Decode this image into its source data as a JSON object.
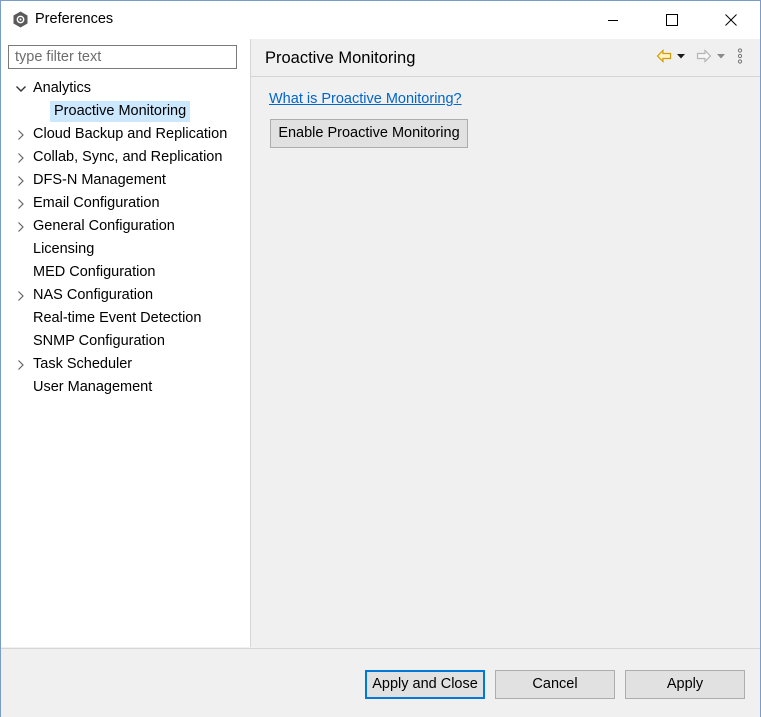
{
  "window": {
    "title": "Preferences",
    "icon": "app-gear-icon"
  },
  "filter": {
    "placeholder": "type filter text",
    "value": ""
  },
  "tree": {
    "items": [
      {
        "label": "Analytics",
        "expanded": true,
        "has_children": true
      },
      {
        "label": "Proactive Monitoring",
        "child": true,
        "selected": true
      },
      {
        "label": "Cloud Backup and Replication",
        "has_children": true
      },
      {
        "label": "Collab, Sync, and Replication",
        "has_children": true
      },
      {
        "label": "DFS-N Management",
        "has_children": true
      },
      {
        "label": "Email Configuration",
        "has_children": true
      },
      {
        "label": "General Configuration",
        "has_children": true
      },
      {
        "label": "Licensing",
        "has_children": false
      },
      {
        "label": "MED Configuration",
        "has_children": false
      },
      {
        "label": "NAS Configuration",
        "has_children": true
      },
      {
        "label": "Real-time Event Detection",
        "has_children": false
      },
      {
        "label": "SNMP Configuration",
        "has_children": false
      },
      {
        "label": "Task Scheduler",
        "has_children": true
      },
      {
        "label": "User Management",
        "has_children": false
      }
    ]
  },
  "page": {
    "title": "Proactive Monitoring",
    "help_link": "What is Proactive Monitoring?",
    "enable_button": "Enable Proactive Monitoring"
  },
  "footer": {
    "apply_close": "Apply and Close",
    "cancel": "Cancel",
    "apply": "Apply"
  },
  "colors": {
    "selection": "#cce8ff",
    "link": "#0066cc",
    "default_button_border": "#0078d7",
    "back_arrow": "#e0a000"
  }
}
